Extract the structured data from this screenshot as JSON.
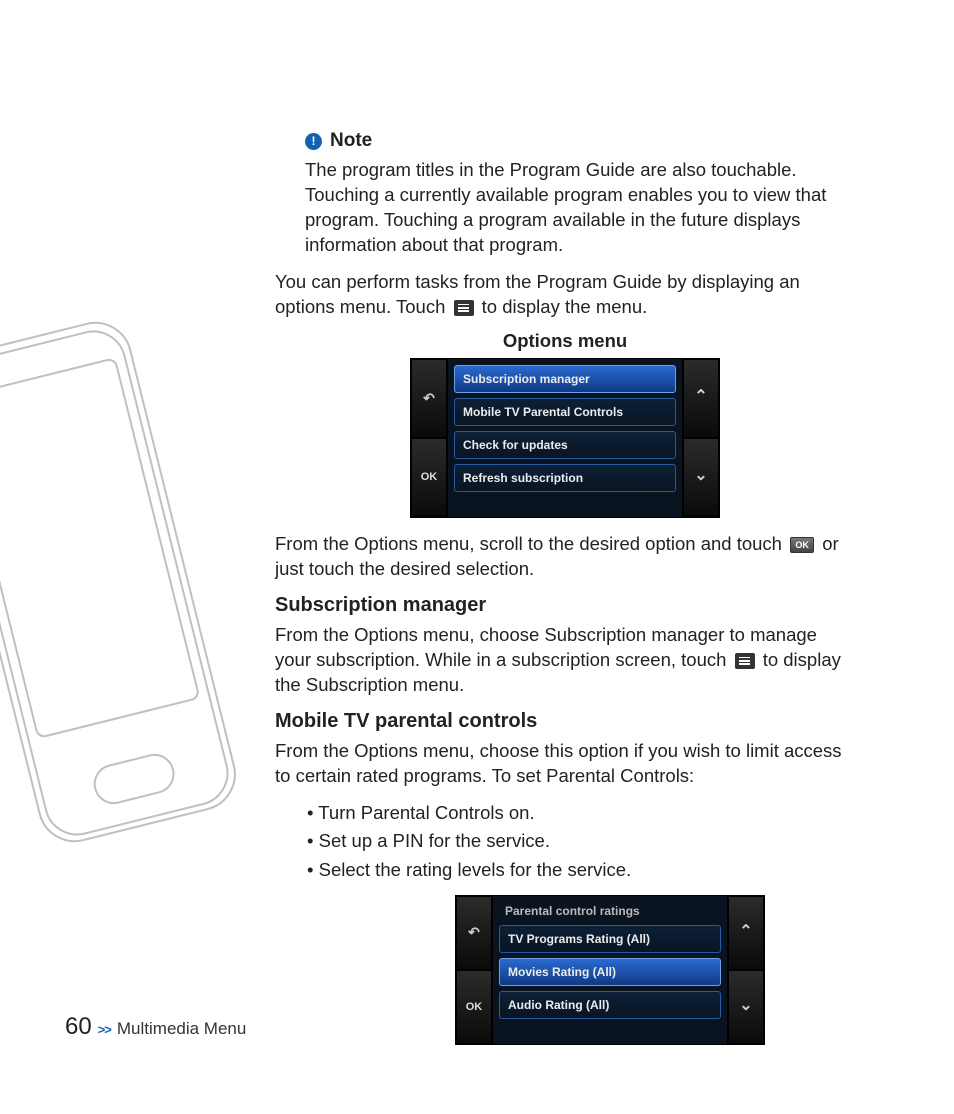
{
  "note": {
    "label": "Note",
    "icon_char": "!",
    "body": "The program titles in the Program Guide are also touchable. Touching a currently available program enables you to view that program. Touching a program available in the future displays information about that program."
  },
  "para1a": "You can perform tasks from the Program Guide by displaying an options menu. Touch ",
  "para1b": " to display the menu.",
  "options_caption": "Options menu",
  "options_menu": {
    "left": {
      "back": "↶",
      "ok": "OK"
    },
    "right": {
      "up": "⌃",
      "down": "⌄"
    },
    "items": [
      "Subscription manager",
      "Mobile TV Parental Controls",
      "Check for updates",
      "Refresh subscription"
    ],
    "selected_index": 0
  },
  "para2a": "From the Options menu, scroll to the desired option and touch ",
  "para2b": " or just touch the desired selection.",
  "ok_label": "OK",
  "sub_manager": {
    "heading": "Subscription manager",
    "body_a": "From the Options menu, choose Subscription manager to manage your subscription. While in a subscription screen, touch ",
    "body_b": " to display the Subscription menu."
  },
  "parental": {
    "heading": "Mobile TV parental controls",
    "body": "From the Options menu, choose this option if you wish to limit access to certain rated programs. To set Parental Controls:",
    "bullets": [
      "Turn Parental Controls on.",
      "Set up a PIN for the service.",
      "Select the rating levels for the service."
    ]
  },
  "ratings_menu": {
    "left": {
      "back": "↶",
      "ok": "OK"
    },
    "right": {
      "up": "⌃",
      "down": "⌄"
    },
    "title": "Parental control ratings",
    "items": [
      "TV Programs Rating (All)",
      "Movies Rating (All)",
      "Audio Rating (All)"
    ],
    "selected_index": 1
  },
  "footer": {
    "page": "60",
    "chev": ">>",
    "label": "Multimedia Menu"
  }
}
